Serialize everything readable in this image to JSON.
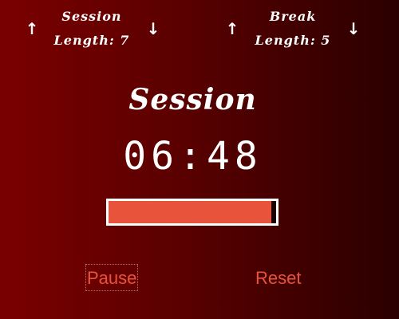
{
  "session": {
    "label_line1": "Session",
    "label_line2": "Length: 7",
    "up_icon": "↑",
    "down_icon": "↓"
  },
  "break": {
    "label_line1": "Break",
    "label_line2": "Length: 5",
    "up_icon": "↑",
    "down_icon": "↓"
  },
  "timer": {
    "label": "Session",
    "time_left": "06:48",
    "progress": 0.97
  },
  "buttons": {
    "pause_label": "Pause",
    "reset_label": "Reset"
  },
  "colors": {
    "accent": "#e8533c",
    "background_left": "#7a0000",
    "background_right": "#2a0000"
  }
}
